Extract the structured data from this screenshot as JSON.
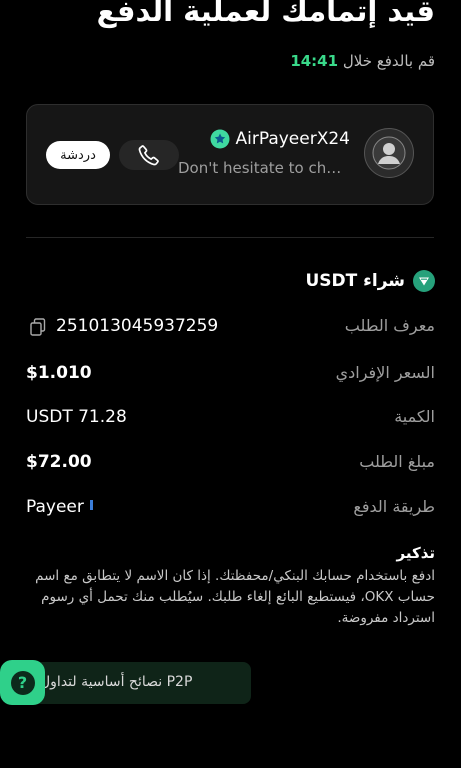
{
  "header": {
    "title": "قيد إتمامك لعملية الدفع",
    "timer_label": "قم بالدفع خلال",
    "timer_value": "14:41"
  },
  "merchant": {
    "name": "AirPayeerX24",
    "subtext": "Don't hesitate to chat with me",
    "chat_label": "دردشة"
  },
  "order": {
    "buy_label": "شراء USDT",
    "fields": [
      {
        "label": "معرف الطلب",
        "value": "251013045937259"
      },
      {
        "label": "السعر الإفرادي",
        "value": "$1.010"
      },
      {
        "label": "الكمية",
        "value": "USDT 71.28"
      },
      {
        "label": "مبلغ الطلب",
        "value": "$72.00"
      },
      {
        "label": "طريقة الدفع",
        "value": "Payeer"
      }
    ]
  },
  "reminder": {
    "title": "تذكير",
    "text": "ادفع باستخدام حسابك البنكي/محفظتك. إذا كان الاسم لا يتطابق مع اسم حساب OKX، فيستطيع البائع إلغاء طلبك. سيُطلب منك تحمل أي رسوم استرداد مفروضة."
  },
  "tips": {
    "label": "نصائح أساسية لتداول P2P",
    "help_glyph": "?"
  },
  "colors": {
    "background": "#000000",
    "accent_green": "#39d98a",
    "card_bg": "#161616",
    "payeer_blue": "#3b7dd8"
  }
}
